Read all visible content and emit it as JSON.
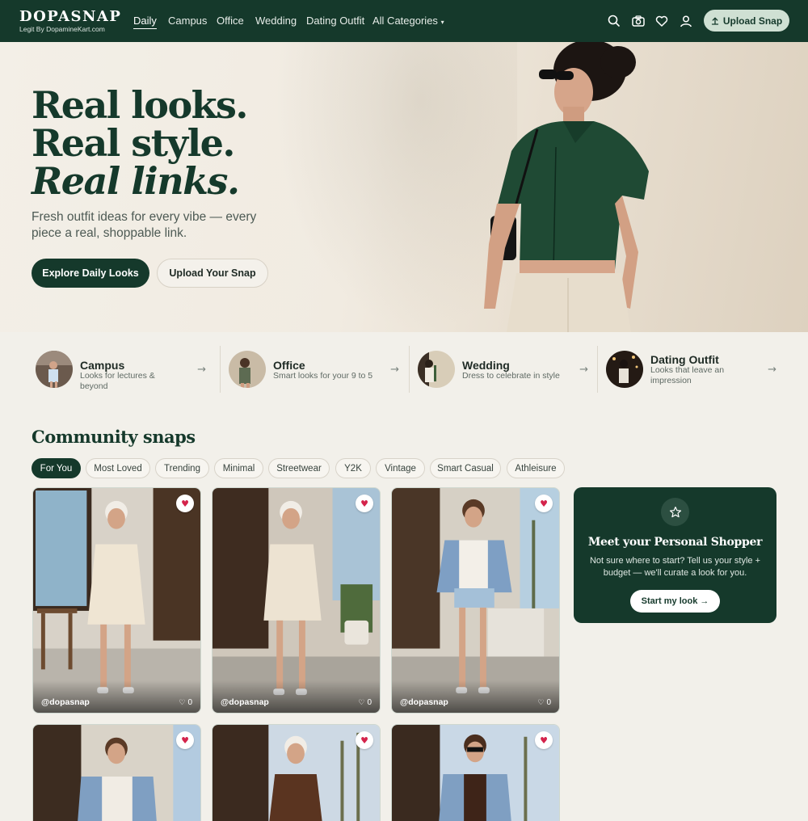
{
  "brand": {
    "name": "DOPASNAP",
    "tagline": "Legit By DopamineKart.com"
  },
  "nav": {
    "links": [
      "Daily",
      "Campus",
      "Office",
      "Wedding",
      "Dating Outfit",
      "All Categories"
    ],
    "dropdown_caret": "▾",
    "icons": [
      "search-icon",
      "camera-icon",
      "heart-icon",
      "user-icon"
    ],
    "upload_label": "Upload Snap",
    "upload_icon": "upload-icon"
  },
  "hero": {
    "line1": "Real looks.",
    "line2": "Real style.",
    "line3": "Real links.",
    "subtitle": "Fresh outfit ideas for every vibe — every piece a real, shoppable link.",
    "primary_cta": "Explore Daily Looks",
    "secondary_cta": "Upload Your Snap"
  },
  "categories": [
    {
      "title": "Campus",
      "desc": "Looks for lectures & beyond"
    },
    {
      "title": "Office",
      "desc": "Smart looks for your 9 to 5"
    },
    {
      "title": "Wedding",
      "desc": "Dress to celebrate in style"
    },
    {
      "title": "Dating Outfit",
      "desc": "Looks that leave an impression"
    }
  ],
  "arrow": "→",
  "community": {
    "title": "Community snaps",
    "filters": [
      "For You",
      "Most Loved",
      "Trending",
      "Minimal",
      "Streetwear",
      "Y2K",
      "Vintage",
      "Smart Casual",
      "Athleisure"
    ],
    "active_filter": "For You",
    "snaps": [
      {
        "user": "@dopasnap",
        "likes": "0"
      },
      {
        "user": "@dopasnap",
        "likes": "0"
      },
      {
        "user": "@dopasnap",
        "likes": "0"
      },
      {
        "user": "",
        "likes": ""
      },
      {
        "user": "",
        "likes": ""
      },
      {
        "user": "",
        "likes": ""
      }
    ],
    "like_glyph": "♥",
    "count_glyph": "♡"
  },
  "shopper": {
    "title": "Meet your Personal Shopper",
    "text": "Not sure where to start? Tell us your style + budget — we'll curate a look for you.",
    "cta": "Start my look →",
    "icon": "star-icon"
  },
  "colors": {
    "brand_green": "#15392b",
    "accent_light": "#cfe0d3",
    "like_red": "#d4234b",
    "page_bg": "#f2f0ea"
  }
}
